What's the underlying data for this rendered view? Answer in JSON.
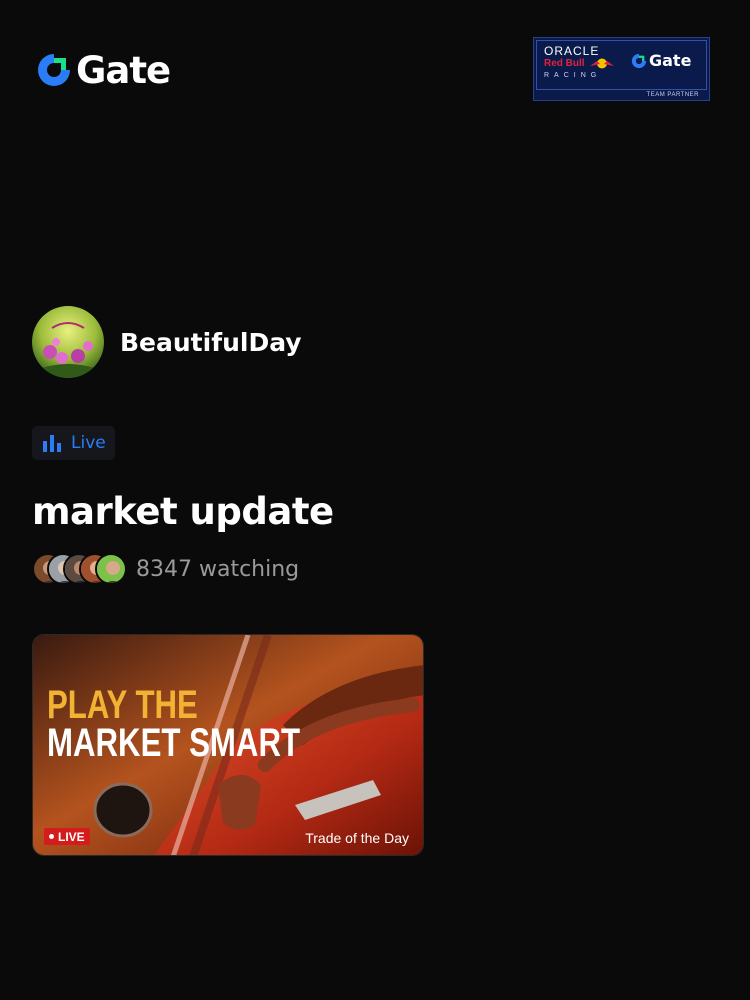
{
  "brand": {
    "name": "Gate",
    "accent": "#2a7df6",
    "green": "#17e08a"
  },
  "partner_badge": {
    "line1": "ORACLE",
    "line2": "Red Bull",
    "line3": "RACING",
    "brand": "Gate",
    "caption": "TEAM PARTNER"
  },
  "host": {
    "name": "BeautifulDay",
    "avatar": "avatar"
  },
  "status": {
    "label": "Live",
    "icon": "bar-chart-icon"
  },
  "stream": {
    "title": "market update",
    "watching": "8347 watching"
  },
  "thumbnail": {
    "headline1": "PLAY THE",
    "headline2": "MARKET SMART",
    "badge": "LIVE",
    "caption": "Trade of the Day"
  }
}
